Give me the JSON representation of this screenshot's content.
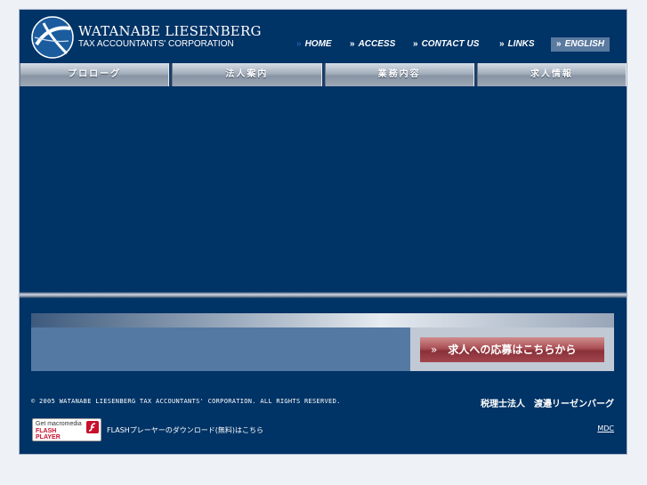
{
  "header": {
    "company_name": "WATANABE LIESENBERG",
    "company_subtitle": "TAX ACCOUNTANTS' CORPORATION",
    "logo_icon": "globe-logo-icon"
  },
  "top_nav": {
    "home": "HOME",
    "access": "ACCESS",
    "contact": "CONTACT US",
    "links": "LINKS",
    "english": "ENGLISH",
    "chevron": "»"
  },
  "main_menu": {
    "item1": "プロローグ",
    "item2": "法人案内",
    "item3": "業務内容",
    "item4": "求人情報"
  },
  "recruit": {
    "chevron": "»",
    "label": "求人への応募はこちらから"
  },
  "footer": {
    "copyright": "© 2005 WATANABE LIESENBERG TAX ACCOUNTANTS' CORPORATION. ALL RIGHTS RESERVED.",
    "japanese_name": "税理士法人　渡邉リーゼンバーグ",
    "flash_badge_top": "Get macromedia",
    "flash_badge_line1": "FLASH",
    "flash_badge_line2": "PLAYER",
    "flash_download": "FLASHプレーヤーのダウンロード(無料)はこちら",
    "mdc": "MDC"
  },
  "colors": {
    "background": "#003366",
    "page": "#eef1f6",
    "recruit_button": "#9a3a42",
    "banner": "#547aa3"
  }
}
